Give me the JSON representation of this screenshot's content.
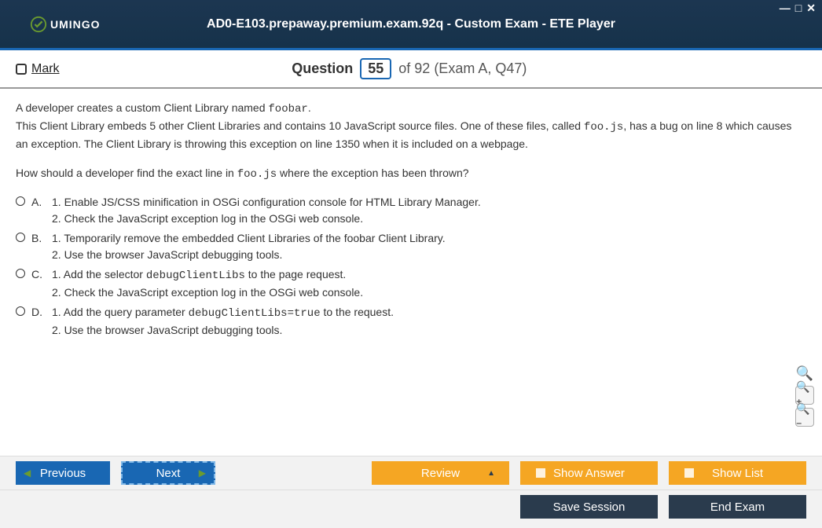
{
  "titlebar": {
    "app_name": "UMINGO",
    "title": "AD0-E103.prepaway.premium.exam.92q - Custom Exam - ETE Player"
  },
  "subheader": {
    "mark_label": "Mark",
    "question_word": "Question",
    "current_num": "55",
    "of_text": "of 92 (Exam A, Q47)"
  },
  "question": {
    "para1_pre": "A developer creates a custom Client Library named ",
    "para1_code": "foobar",
    "para1_post": ".",
    "para2_pre": "This Client Library embeds 5 other Client Libraries and contains 10 JavaScript source files. One of these files, called ",
    "para2_code": "foo.js",
    "para2_post": ", has a bug on line 8 which causes an exception. The Client Library is throwing this exception on line 1350 when it is included on a webpage.",
    "para3_pre": "How should a developer find the exact line in ",
    "para3_code": "foo.js",
    "para3_post": " where the exception has been thrown?"
  },
  "options": {
    "A": {
      "letter": "A.",
      "line1": "1. Enable JS/CSS minification in OSGi configuration console for HTML Library Manager.",
      "line2": "2. Check the JavaScript exception log in the OSGi web console."
    },
    "B": {
      "letter": "B.",
      "line1": "1. Temporarily remove the embedded Client Libraries of the foobar Client Library.",
      "line2": "2. Use the browser JavaScript debugging tools."
    },
    "C": {
      "letter": "C.",
      "line1_pre": "1. Add the selector ",
      "line1_code": "debugClientLibs",
      "line1_post": " to the page request.",
      "line2": "2. Check the JavaScript exception log in the OSGi web console."
    },
    "D": {
      "letter": "D.",
      "line1_pre": "1. Add the query parameter ",
      "line1_code": "debugClientLibs=true",
      "line1_post": " to the request.",
      "line2": "2. Use the browser JavaScript debugging tools."
    }
  },
  "footer": {
    "previous": "Previous",
    "next": "Next",
    "review": "Review",
    "show_answer": "Show Answer",
    "show_list": "Show List",
    "save_session": "Save Session",
    "end_exam": "End Exam"
  }
}
